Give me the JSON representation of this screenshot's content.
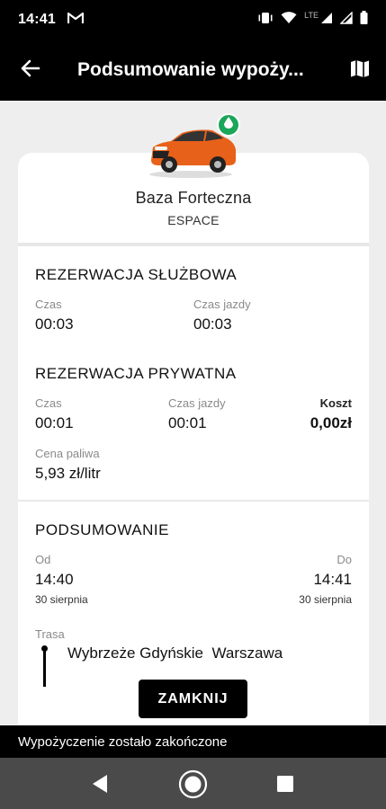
{
  "status_bar": {
    "time": "14:41",
    "network": "LTE"
  },
  "header": {
    "title": "Podsumowanie wypoży..."
  },
  "vehicle": {
    "zone": "Baza Forteczna",
    "model": "ESPACE"
  },
  "business": {
    "title": "REZERWACJA SŁUŻBOWA",
    "time_label": "Czas",
    "time_value": "00:03",
    "drive_label": "Czas jazdy",
    "drive_value": "00:03"
  },
  "private": {
    "title": "REZERWACJA PRYWATNA",
    "time_label": "Czas",
    "time_value": "00:01",
    "drive_label": "Czas jazdy",
    "drive_value": "00:01",
    "cost_label": "Koszt",
    "cost_value": "0,00zł",
    "fuel_label": "Cena paliwa",
    "fuel_value": "5,93 zł/litr"
  },
  "summary": {
    "title": "PODSUMOWANIE",
    "from_label": "Od",
    "from_time": "14:40",
    "from_date": "30 sierpnia",
    "to_label": "Do",
    "to_time": "14:41",
    "to_date": "30 sierpnia",
    "route_label": "Trasa",
    "route_text": "Wybrzeże Gdyńskie  Warszawa"
  },
  "actions": {
    "close_label": "ZAMKNIJ"
  },
  "snackbar": {
    "message": "Wypożyczenie zostało zakończone"
  },
  "colors": {
    "accent": "#000000",
    "eco_badge": "#1ba65a",
    "car": "#e8611a"
  }
}
